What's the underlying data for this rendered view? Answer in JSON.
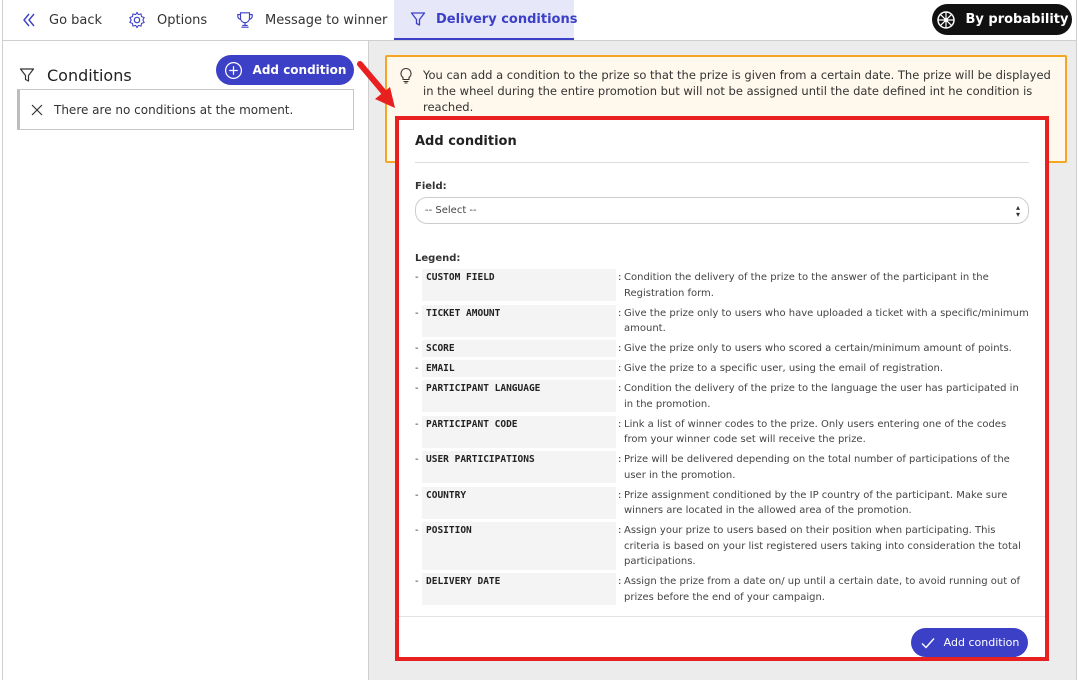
{
  "nav": {
    "back_label": "Go back",
    "options_label": "Options",
    "message_label": "Message to winner",
    "delivery_label": "Delivery conditions",
    "probability_label": "By probability"
  },
  "conditions": {
    "title": "Conditions",
    "add_button": "Add condition",
    "empty_text": "There are no conditions at the moment."
  },
  "info": {
    "text": "You can add a condition to the prize so that the prize is given from a certain date. The prize will be displayed in the wheel during the entire promotion but will not be assigned until the date defined int he condition is reached."
  },
  "card": {
    "title": "Add condition",
    "field_label": "Field:",
    "select_value": "-- Select --",
    "legend_label": "Legend:",
    "submit_label": "Add condition",
    "legend": [
      {
        "dash": "-",
        "key": "CUSTOM FIELD",
        "colon": ":",
        "desc": "Condition the delivery of the prize to the answer of the participant in the Registration form."
      },
      {
        "dash": "-",
        "key": "TICKET AMOUNT",
        "colon": ":",
        "desc": "Give the prize only to users who have uploaded a ticket with a specific/minimum amount."
      },
      {
        "dash": "-",
        "key": "SCORE",
        "colon": ":",
        "desc": "Give the prize only to users who scored a certain/minimum amount of points."
      },
      {
        "dash": "-",
        "key": "EMAIL",
        "colon": ":",
        "desc": "Give the prize to a specific user, using the email of registration."
      },
      {
        "dash": "-",
        "key": "PARTICIPANT LANGUAGE",
        "colon": ":",
        "desc": "Condition the delivery of the prize to the language the user has participated in in the promotion."
      },
      {
        "dash": "-",
        "key": "PARTICIPANT CODE",
        "colon": ":",
        "desc": "Link a list of winner codes to the prize. Only users entering one of the codes from your winner code set will receive the prize."
      },
      {
        "dash": "-",
        "key": "USER PARTICIPATIONS",
        "colon": ":",
        "desc": "Prize will be delivered depending on the total number of participations of the user in the promotion."
      },
      {
        "dash": "-",
        "key": "COUNTRY",
        "colon": ":",
        "desc": "Prize assignment conditioned by the IP country of the participant. Make sure winners are located in the allowed area of the promotion."
      },
      {
        "dash": "-",
        "key": "POSITION",
        "colon": ":",
        "desc": "Assign your prize to users based on their position when participating. This criteria is based on your list registered users taking into consideration the total participations."
      },
      {
        "dash": "-",
        "key": "DELIVERY DATE",
        "colon": ":",
        "desc": "Assign the prize from a date on/ up until a certain date, to avoid running out of prizes before the end of your campaign."
      }
    ]
  },
  "colors": {
    "accent": "#3c40c6",
    "highlight_border": "#e8201f",
    "info_border": "#f5a623",
    "info_bg": "#fff8ec"
  },
  "icons": {
    "back": "chevron-double-left-icon",
    "options": "gear-icon",
    "message": "trophy-icon",
    "delivery": "filter-icon",
    "probability": "wheel-icon",
    "conditions": "filter-icon",
    "add": "plus-circle-icon",
    "empty": "close-icon",
    "info": "lightbulb-icon",
    "submit": "check-icon",
    "annotation": "red-arrow-icon"
  }
}
